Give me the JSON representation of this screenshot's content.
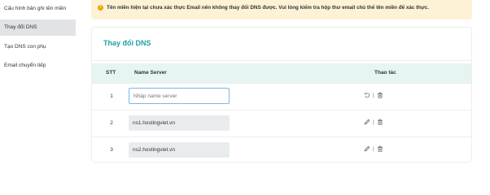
{
  "sidebar": {
    "items": [
      {
        "label": "Cấu hình bản ghi tên miền"
      },
      {
        "label": "Thay đổi DNS",
        "active": true
      },
      {
        "label": "Tạo DNS con phụ"
      },
      {
        "label": "Email chuyển tiếp"
      }
    ]
  },
  "alert": {
    "text": "Tên miền hiện tại chưa xác thực Email nên không thay đổi DNS được. Vui lòng kiểm tra hộp thư email chủ thể tên miền để xác thực.",
    "color": "#fdf2d6"
  },
  "card": {
    "title": "Thay đổi DNS",
    "headers": {
      "stt": "STT",
      "name_server": "Name Server",
      "actions": "Thao tác"
    },
    "rows": [
      {
        "stt": "1",
        "placeholder": "Nhập name server",
        "value": ""
      },
      {
        "stt": "2",
        "value": "ns1.hostingviet.vn"
      },
      {
        "stt": "3",
        "value": "ns2.hostingviet.vn"
      }
    ],
    "separator": "|"
  },
  "colors": {
    "accent": "#1fa0a8",
    "header_bg": "#e6f5f1",
    "active_side": "#e1e3e6"
  },
  "icons": {
    "warning": "warning-icon",
    "undo": "undo-icon",
    "edit": "edit-icon",
    "delete": "trash-icon"
  }
}
